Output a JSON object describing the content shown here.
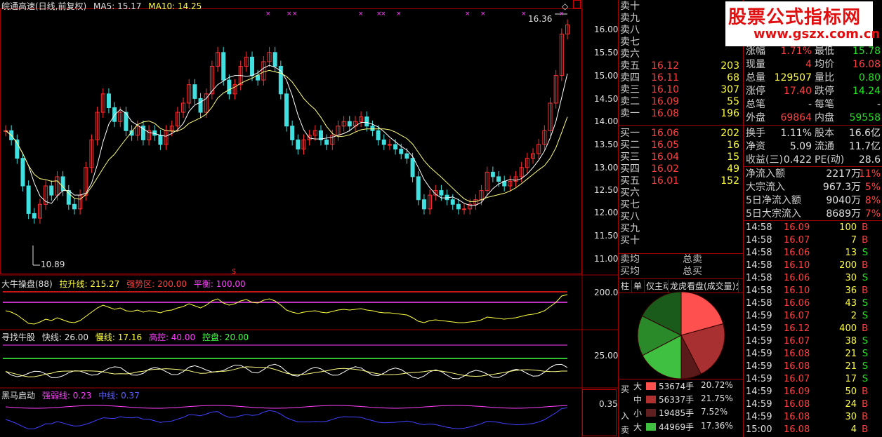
{
  "chart_header": {
    "stock_name": "皖通高速(日线,前复权)",
    "ma5_label": "MA5: 15.17",
    "ma10_label": "MA10: 14.25",
    "high_marker": "16.36",
    "low_marker": "10.89"
  },
  "price_axis": [
    "16.00",
    "15.50",
    "15.00",
    "14.50",
    "14.00",
    "13.50",
    "13.00",
    "12.50",
    "12.00",
    "11.50",
    "11.00"
  ],
  "indicator1": {
    "name": "大牛操盘(88)",
    "line1": "拉升线: 215.27",
    "line2": "强势区: 200.00",
    "line3": "平衡: 100.00",
    "axis_label": "200.0"
  },
  "indicator2": {
    "name": "寻找牛股",
    "line1": "快线: 26.00",
    "line2": "慢线: 17.16",
    "line3": "高控: 40.00",
    "line4": "控盘: 20.00",
    "axis_label": "25.00"
  },
  "indicator3": {
    "name": "黑马启动",
    "line1": "强弱线: 0.23",
    "line2": "中线: 0.37",
    "axis_label": "0.35"
  },
  "sell_levels": [
    {
      "label": "卖十",
      "price": "",
      "vol": ""
    },
    {
      "label": "卖九",
      "price": "",
      "vol": ""
    },
    {
      "label": "卖八",
      "price": "",
      "vol": ""
    },
    {
      "label": "卖七",
      "price": "",
      "vol": ""
    },
    {
      "label": "卖六",
      "price": "",
      "vol": ""
    },
    {
      "label": "卖五",
      "price": "16.12",
      "vol": "203"
    },
    {
      "label": "卖四",
      "price": "16.11",
      "vol": "68"
    },
    {
      "label": "卖三",
      "price": "16.10",
      "vol": "307"
    },
    {
      "label": "卖二",
      "price": "16.09",
      "vol": "55"
    },
    {
      "label": "卖一",
      "price": "16.08",
      "vol": "196"
    }
  ],
  "buy_levels": [
    {
      "label": "买一",
      "price": "16.06",
      "vol": "202"
    },
    {
      "label": "买二",
      "price": "16.05",
      "vol": "16"
    },
    {
      "label": "买三",
      "price": "16.04",
      "vol": "15"
    },
    {
      "label": "买四",
      "price": "16.02",
      "vol": "49"
    },
    {
      "label": "买五",
      "price": "16.01",
      "vol": "152"
    },
    {
      "label": "买六",
      "price": "",
      "vol": ""
    },
    {
      "label": "买七",
      "price": "",
      "vol": ""
    },
    {
      "label": "买八",
      "price": "",
      "vol": ""
    },
    {
      "label": "买九",
      "price": "",
      "vol": ""
    },
    {
      "label": "买十",
      "price": "",
      "vol": ""
    }
  ],
  "avg": {
    "sell_avg": "卖均",
    "buy_avg": "买均",
    "total_sell": "总卖",
    "total_buy": "总买"
  },
  "tabs": [
    "柱",
    "单",
    "仅主动",
    "龙虎看盘(成交量)分"
  ],
  "watermark": {
    "line1": "股票公式指标网",
    "line2": "www.gszx.com.cn"
  },
  "stats": [
    {
      "l1": "涨幅",
      "v1": "1.71%",
      "c1": "red",
      "l2": "最低",
      "v2": "15.78",
      "c2": "green"
    },
    {
      "l1": "现量",
      "v1": "4",
      "c1": "red",
      "l2": "均价",
      "v2": "16.08",
      "c2": "red"
    },
    {
      "l1": "总量",
      "v1": "129507",
      "c1": "yellow",
      "l2": "量比",
      "v2": "0.80",
      "c2": "green"
    },
    {
      "l1": "涨停",
      "v1": "17.40",
      "c1": "red",
      "l2": "跌停",
      "v2": "14.24",
      "c2": "green"
    },
    {
      "l1": "总笔",
      "v1": "-",
      "c1": "white",
      "l2": "每笔",
      "v2": "-",
      "c2": "white"
    },
    {
      "l1": "外盘",
      "v1": "69864",
      "c1": "red",
      "l2": "内盘",
      "v2": "59558",
      "c2": "green"
    }
  ],
  "stats2": [
    {
      "l1": "换手",
      "v1": "1.11%",
      "l2": "股本",
      "v2": "16.6亿"
    },
    {
      "l1": "净资",
      "v1": "5.09",
      "l2": "流通",
      "v2": "11.7亿"
    },
    {
      "l1": "收益(三)",
      "v1": "0.422",
      "l2": "PE(动)",
      "v2": "28.6"
    }
  ],
  "flows": [
    {
      "label": "净流入额",
      "val": "2217万",
      "pct": "11%"
    },
    {
      "label": "大宗流入",
      "val": "967.3万",
      "pct": "5%"
    },
    {
      "label": "5日净流入额",
      "val": "9040万",
      "pct": "8%"
    },
    {
      "label": "5日大宗流入",
      "val": "8689万",
      "pct": "7%"
    }
  ],
  "ticks": [
    {
      "t": "14:58",
      "p": "16.09",
      "v": "100",
      "s": "B"
    },
    {
      "t": "14:58",
      "p": "16.07",
      "v": "7",
      "s": "B"
    },
    {
      "t": "14:58",
      "p": "16.06",
      "v": "13",
      "s": "S"
    },
    {
      "t": "14:58",
      "p": "16.10",
      "v": "200",
      "s": "B"
    },
    {
      "t": "14:58",
      "p": "16.06",
      "v": "30",
      "s": "S"
    },
    {
      "t": "14:58",
      "p": "16.10",
      "v": "36",
      "s": "B"
    },
    {
      "t": "14:58",
      "p": "16.06",
      "v": "43",
      "s": "S"
    },
    {
      "t": "14:59",
      "p": "16.07",
      "v": "2",
      "s": "S"
    },
    {
      "t": "14:59",
      "p": "16.12",
      "v": "400",
      "s": "B"
    },
    {
      "t": "14:59",
      "p": "16.07",
      "v": "38",
      "s": "S"
    },
    {
      "t": "14:59",
      "p": "16.08",
      "v": "21",
      "s": "S"
    },
    {
      "t": "14:59",
      "p": "16.08",
      "v": "21",
      "s": "S"
    },
    {
      "t": "14:59",
      "p": "16.07",
      "v": "17",
      "s": "S"
    },
    {
      "t": "14:59",
      "p": "16.09",
      "v": "50",
      "s": "B"
    },
    {
      "t": "14:59",
      "p": "16.08",
      "v": "24",
      "s": "B"
    },
    {
      "t": "14:59",
      "p": "16.08",
      "v": "30",
      "s": "B"
    },
    {
      "t": "15:00",
      "p": "16.08",
      "v": "4",
      "s": "B"
    }
  ],
  "order_split": {
    "buy_label": "买",
    "in_label": "入",
    "sell_label": "卖",
    "rows": [
      {
        "size": "大",
        "hands": "53674手",
        "pct": "20.72%",
        "color": "#ff5050"
      },
      {
        "size": "中",
        "hands": "56337手",
        "pct": "21.75%",
        "color": "#b03030"
      },
      {
        "size": "小",
        "hands": "19485手",
        "pct": "7.52%",
        "color": "#602020"
      },
      {
        "size": "大",
        "hands": "44969手",
        "pct": "17.36%",
        "color": "#40c040"
      }
    ]
  },
  "chart_data": {
    "type": "candlestick",
    "pie": {
      "values": [
        20.72,
        21.75,
        7.52,
        17.36,
        15.0,
        17.65
      ],
      "colors": [
        "#ff5050",
        "#a83030",
        "#5a1a1a",
        "#40c040",
        "#2a8a2a",
        "#1a5a1a"
      ]
    }
  }
}
